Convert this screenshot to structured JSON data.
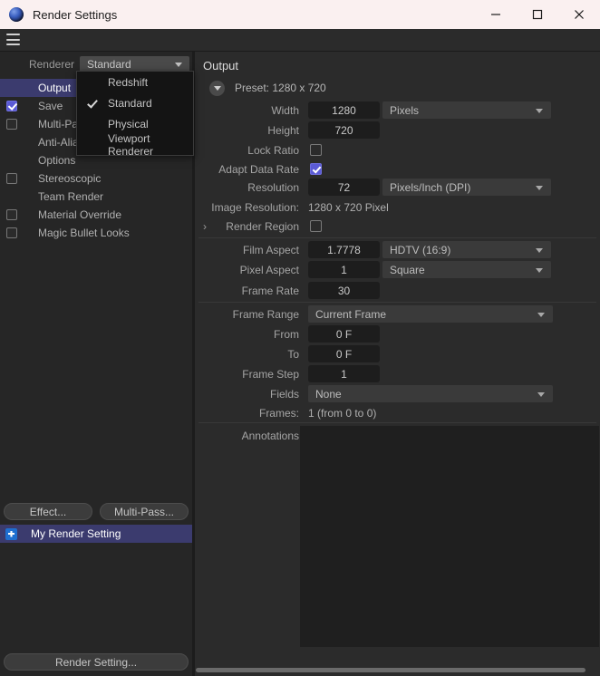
{
  "titlebar": {
    "title": "Render Settings",
    "app_icon": "c4d-sphere-icon",
    "minimize": "—",
    "maximize": "□",
    "close": "✕"
  },
  "menustrip": {
    "hamburger_icon": "hamburger-menu-icon"
  },
  "sidebar": {
    "renderer_label": "Renderer",
    "renderer_value": "Standard",
    "renderer_options": [
      {
        "label": "Redshift",
        "checked": false
      },
      {
        "label": "Standard",
        "checked": true
      },
      {
        "label": "Physical",
        "checked": false
      },
      {
        "label": "Viewport Renderer",
        "checked": false
      }
    ],
    "items": [
      {
        "label": "Output",
        "checkbox": false,
        "checked": false,
        "selected": true
      },
      {
        "label": "Save",
        "checkbox": true,
        "checked": true,
        "selected": false
      },
      {
        "label": "Multi-Pass",
        "checkbox": true,
        "checked": false,
        "selected": false
      },
      {
        "label": "Anti-Aliasing",
        "checkbox": false,
        "checked": false,
        "selected": false
      },
      {
        "label": "Options",
        "checkbox": false,
        "checked": false,
        "selected": false
      },
      {
        "label": "Stereoscopic",
        "checkbox": true,
        "checked": false,
        "selected": false
      },
      {
        "label": "Team Render",
        "checkbox": false,
        "checked": false,
        "selected": false
      },
      {
        "label": "Material Override",
        "checkbox": true,
        "checked": false,
        "selected": false
      },
      {
        "label": "Magic Bullet Looks",
        "checkbox": true,
        "checked": false,
        "selected": false
      }
    ],
    "effect_button": "Effect...",
    "multipass_button": "Multi-Pass...",
    "active_setting": "My Render Setting",
    "active_setting_icon": "render-setting-icon",
    "render_setting_button": "Render Setting..."
  },
  "output": {
    "section_title": "Output",
    "preset_label": "Preset: 1280 x 720",
    "width_label": "Width",
    "width_value": "1280",
    "width_unit": "Pixels",
    "height_label": "Height",
    "height_value": "720",
    "lock_ratio_label": "Lock Ratio",
    "lock_ratio_checked": false,
    "adapt_data_rate_label": "Adapt Data Rate",
    "adapt_data_rate_checked": true,
    "resolution_label": "Resolution",
    "resolution_value": "72",
    "resolution_unit": "Pixels/Inch (DPI)",
    "image_resolution_label": "Image Resolution:",
    "image_resolution_value": "1280 x 720 Pixel",
    "render_region_label": "Render Region",
    "render_region_checked": false,
    "render_region_expand_icon": "chevron-right-icon",
    "film_aspect_label": "Film Aspect",
    "film_aspect_value": "1.7778",
    "film_aspect_preset": "HDTV (16:9)",
    "pixel_aspect_label": "Pixel Aspect",
    "pixel_aspect_value": "1",
    "pixel_aspect_preset": "Square",
    "frame_rate_label": "Frame Rate",
    "frame_rate_value": "30",
    "frame_range_label": "Frame Range",
    "frame_range_value": "Current Frame",
    "from_label": "From",
    "from_value": "0 F",
    "to_label": "To",
    "to_value": "0 F",
    "frame_step_label": "Frame Step",
    "frame_step_value": "1",
    "fields_label": "Fields",
    "fields_value": "None",
    "frames_label": "Frames:",
    "frames_value": "1 (from 0 to 0)",
    "annotations_label": "Annotations",
    "annotations_value": ""
  }
}
